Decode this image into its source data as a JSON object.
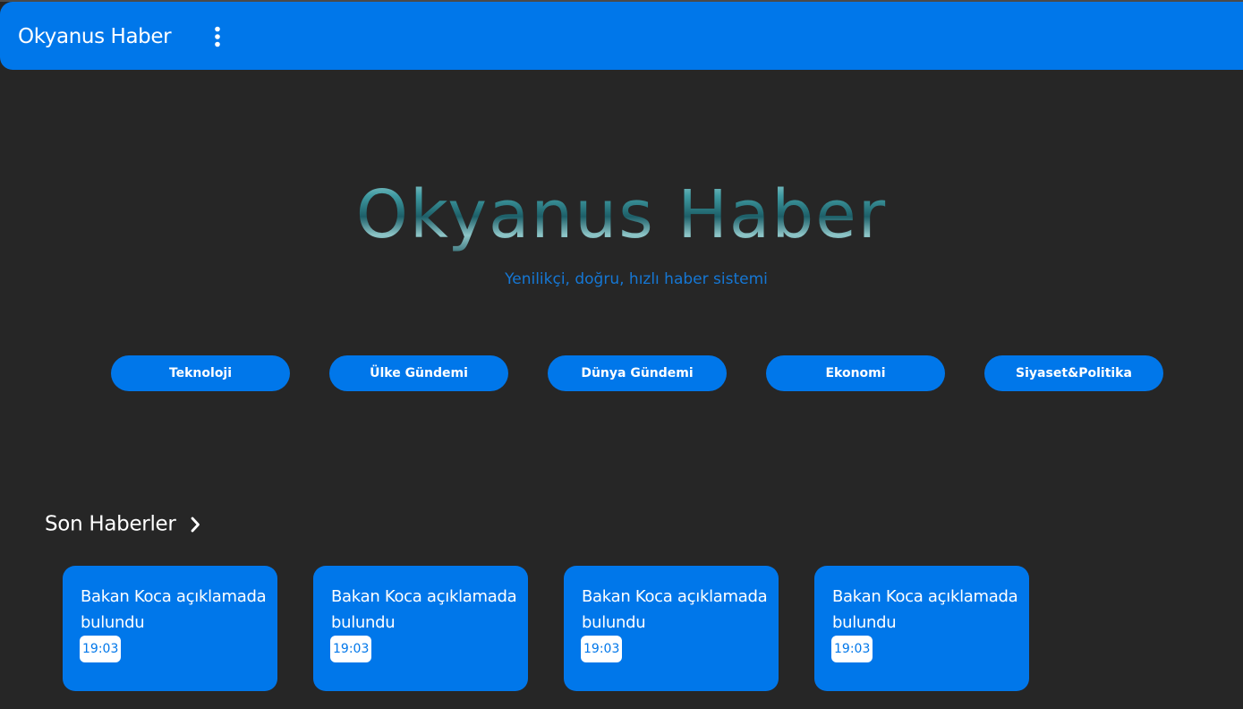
{
  "appbar": {
    "title": "Okyanus Haber",
    "menu_icon": "more-vertical-icon",
    "color": "#0077ea"
  },
  "hero": {
    "title": "Okyanus Haber",
    "subtitle": "Yenilikçi, doğru, hızlı haber sistemi"
  },
  "categories": [
    {
      "label": "Teknoloji"
    },
    {
      "label": "Ülke Gündemi"
    },
    {
      "label": "Dünya Gündemi"
    },
    {
      "label": "Ekonomi"
    },
    {
      "label": "Siyaset&Politika"
    }
  ],
  "latest": {
    "title": "Son Haberler",
    "icon": "chevron-right-icon",
    "items": [
      {
        "title": "Bakan Koca açıklamada bulundu",
        "time": "19:03"
      },
      {
        "title": "Bakan Koca açıklamada bulundu",
        "time": "19:03"
      },
      {
        "title": "Bakan Koca açıklamada bulundu",
        "time": "19:03"
      },
      {
        "title": "Bakan Koca açıklamada bulundu",
        "time": "19:03"
      }
    ]
  },
  "colors": {
    "background": "#262626",
    "accent": "#0077ea",
    "subtitle": "#1577d4",
    "hero_title": "#3f8b91"
  }
}
